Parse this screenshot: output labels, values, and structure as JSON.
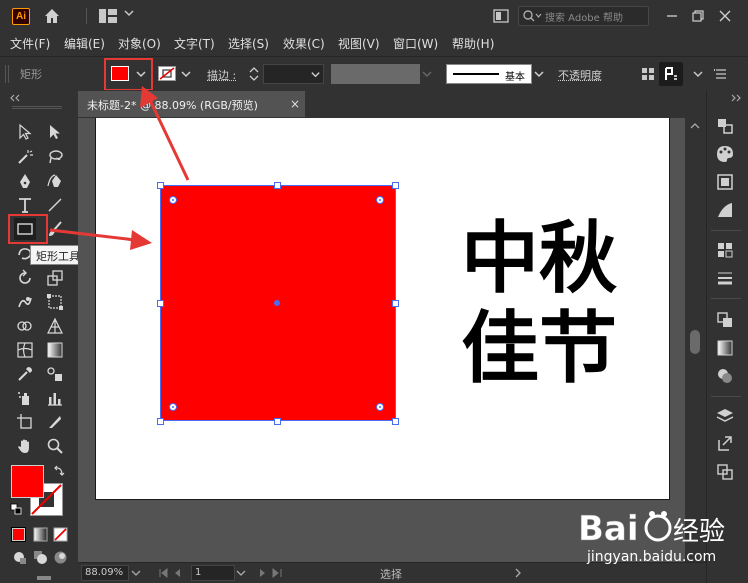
{
  "app": {
    "logo": "Ai",
    "search_placeholder": "搜索 Adobe 帮助"
  },
  "menu": {
    "items": [
      "文件(F)",
      "编辑(E)",
      "对象(O)",
      "文字(T)",
      "选择(S)",
      "效果(C)",
      "视图(V)",
      "窗口(W)",
      "帮助(H)"
    ]
  },
  "control_bar": {
    "tool_label": "矩形",
    "stroke_label": "描边 :",
    "brush_label": "基本",
    "opacity_label": "不透明度",
    "fill_color": "#ff0000"
  },
  "tooltip": {
    "text": "矩形工具 (M)"
  },
  "document": {
    "tab_label": "未标题-2* @ 88.09% (RGB/预览)",
    "close": "×"
  },
  "canvas": {
    "text_line1": "中秋",
    "text_line2": "佳节",
    "rect_color": "#ff0000",
    "selection_color": "#4a6cf5"
  },
  "status_bar": {
    "zoom": "88.09%",
    "page": "1",
    "mode": "选择"
  },
  "watermark": {
    "url": "jingyan.baidu.com"
  },
  "annotation": {
    "color": "#e53935"
  }
}
